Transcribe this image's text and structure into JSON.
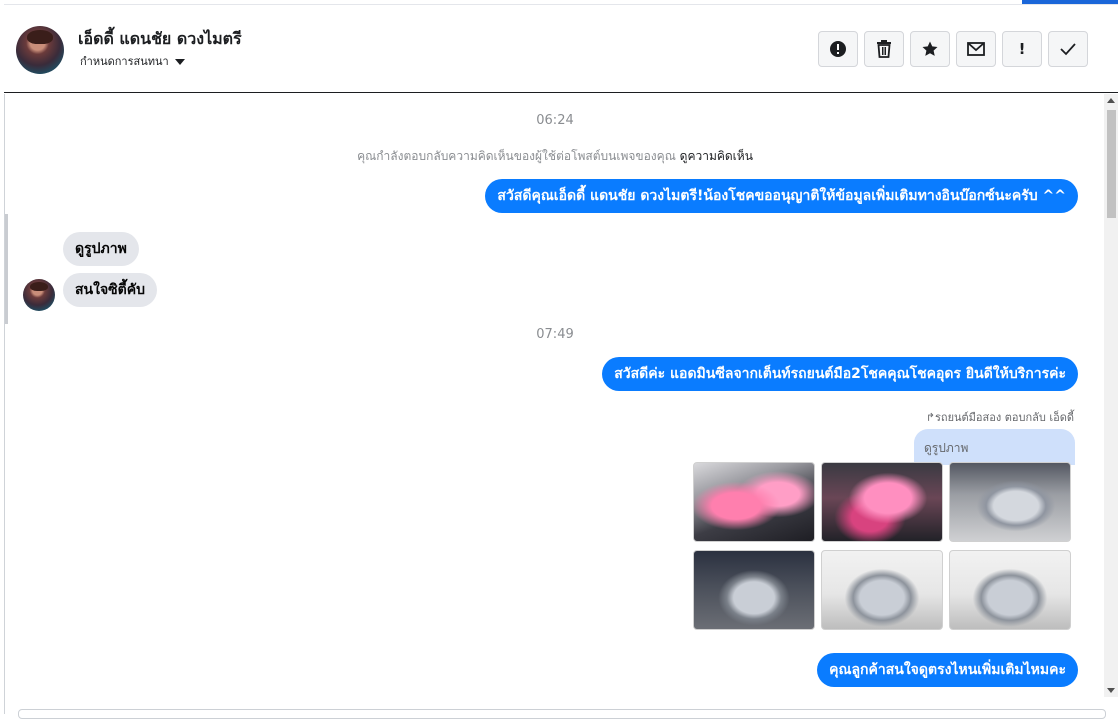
{
  "header": {
    "contact_name": "เอ็ดดี้ แดนชัย ดวงไมตรี",
    "conversation_settings": "กำหนดการสนทนา",
    "actions": [
      {
        "name": "mark-spam-button",
        "icon": "alert-circle-icon"
      },
      {
        "name": "delete-button",
        "icon": "trash-icon"
      },
      {
        "name": "star-button",
        "icon": "star-icon"
      },
      {
        "name": "mark-unread-button",
        "icon": "envelope-icon"
      },
      {
        "name": "important-button",
        "icon": "exclamation-icon",
        "label": "!"
      },
      {
        "name": "mark-done-button",
        "icon": "check-icon"
      }
    ]
  },
  "chat": {
    "time_1": "06:24",
    "notice_text": "คุณกำลังตอบกลับความคิดเห็นของผู้ใช้ต่อโพสต์บนเพจของคุณ",
    "notice_link": "ดูความคิดเห็น",
    "msg_out_1": "สวัสดีคุณเอ็ดดี้ แดนชัย ดวงไมตรี!น้องโชคขออนุญาติให้ข้อมูลเพิ่มเติมทางอินบ๊อกซ์นะครับ ^^",
    "msg_in_1": "ดูรูปภาพ",
    "msg_in_2": "สนใจซิตี้คับ",
    "time_2": "07:49",
    "msg_out_2": "สวัสดีค่ะ แอดมินซีลจากเต็นท์รถยนต์มือ2โชคคุณโชคอุดร ยินดีให้บริการค่ะ",
    "reply_meta": "รถยนต์มือสอง ตอบกลับ เอ็ดดี้",
    "quoted_text": "ดูรูปภาพ",
    "photos": [
      {
        "name": "car-photo-interior-1",
        "style": "t-interior"
      },
      {
        "name": "car-photo-interior-2",
        "style": "t-interior2"
      },
      {
        "name": "car-photo-exterior-1",
        "style": "t-car-show"
      },
      {
        "name": "car-photo-rear",
        "style": "t-car-dark"
      },
      {
        "name": "car-photo-front",
        "style": "t-car"
      },
      {
        "name": "car-photo-exterior-2",
        "style": "t-car"
      }
    ],
    "msg_out_3": "คุณลูกค้าสนใจดูตรงไหนเพิ่มเติมไหมคะ"
  },
  "colors": {
    "outgoing_bubble": "#0a7cff",
    "incoming_bubble": "#e4e6eb",
    "accent": "#1a66d9"
  }
}
